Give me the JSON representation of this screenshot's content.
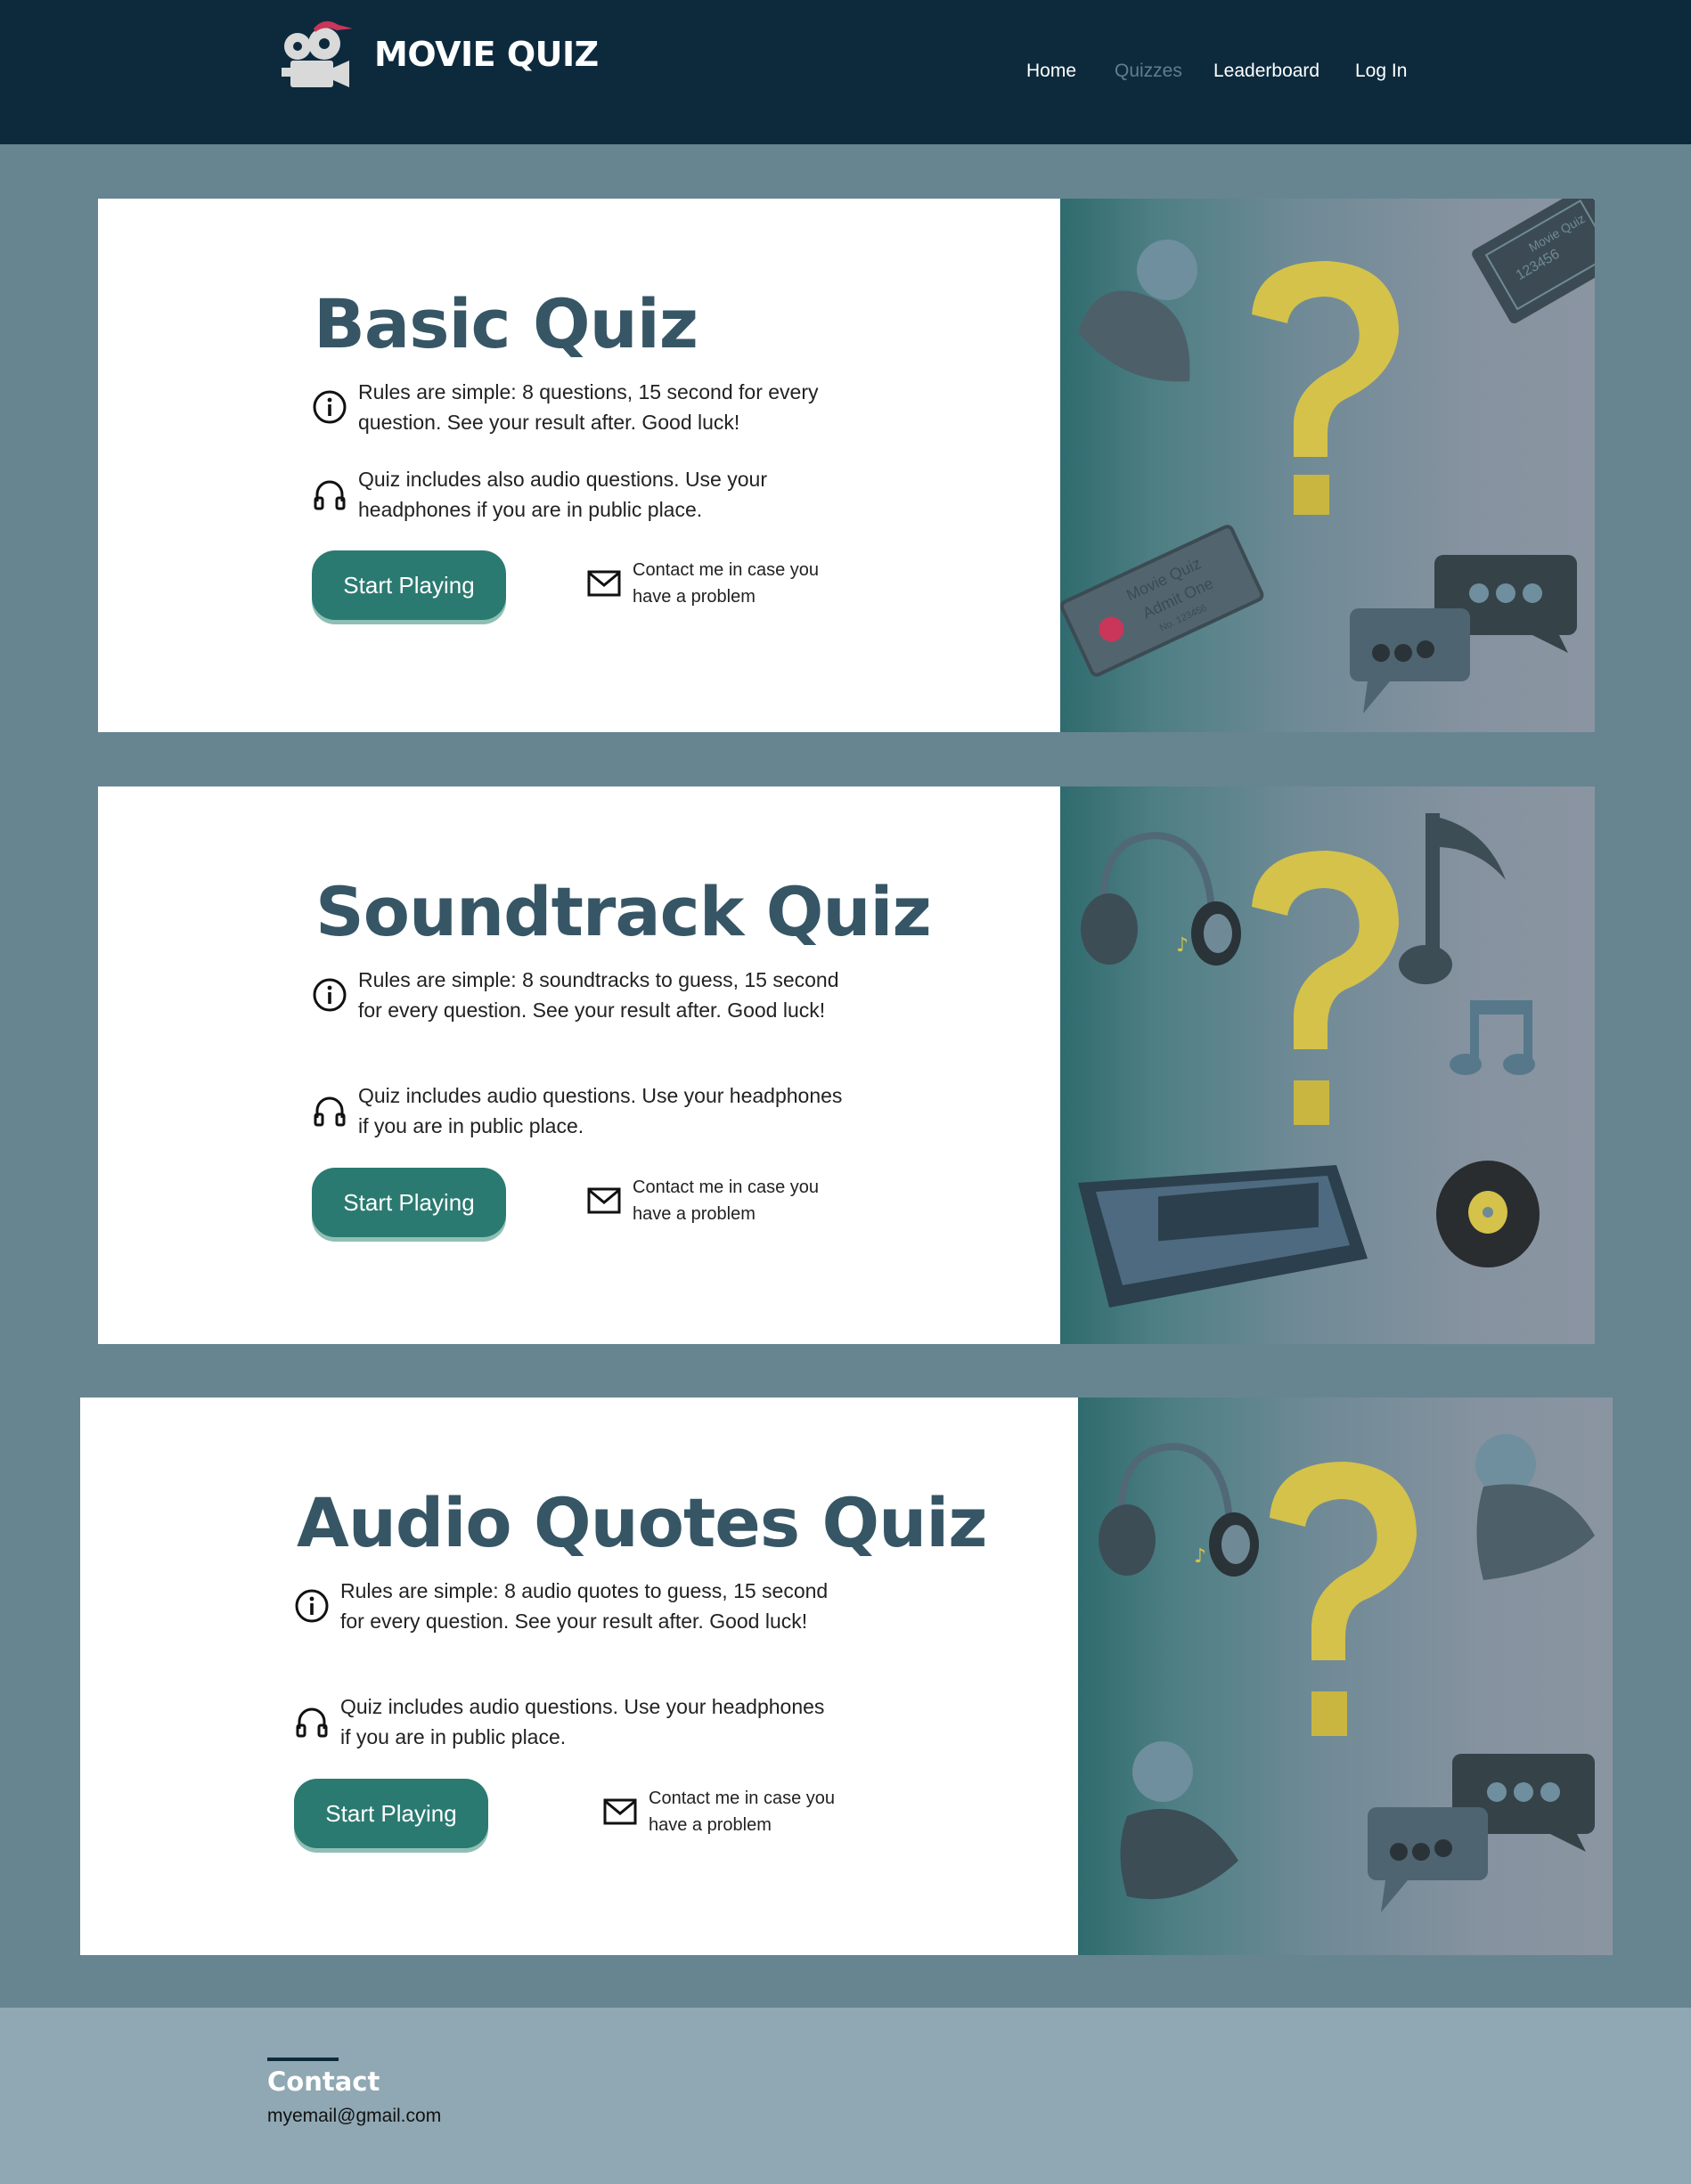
{
  "header": {
    "brand": "MOVIE QUIZ",
    "nav": [
      {
        "label": "Home",
        "active": false
      },
      {
        "label": "Quizzes",
        "active": true
      },
      {
        "label": "Leaderboard",
        "active": false
      },
      {
        "label": "Log In",
        "active": false
      }
    ]
  },
  "quizzes": [
    {
      "title": "Basic Quiz",
      "rules": "Rules are simple: 8 questions, 15 second for every question. See your result after. Good luck!",
      "audio_note": "Quiz includes also audio questions. Use your headphones if you are in public place.",
      "button": "Start Playing",
      "contact": "Contact me in case you have a problem",
      "ticket1": "123456",
      "ticket1_brand": "Movie Quiz",
      "ticket2_brand": "Movie Quiz",
      "ticket2_line": "Admit One",
      "ticket2_no": "No. 123456"
    },
    {
      "title": "Soundtrack Quiz",
      "rules": "Rules are simple: 8 soundtracks to guess, 15 second for every question. See your result after. Good luck!",
      "audio_note": "Quiz includes audio questions. Use your headphones if you are in public place.",
      "button": "Start Playing",
      "contact": "Contact me in case you have a problem"
    },
    {
      "title": "Audio Quotes Quiz",
      "rules": "Rules are simple: 8 audio quotes to guess, 15 second for every question. See your result after. Good luck!",
      "audio_note": "Quiz includes audio questions. Use your headphones if you are in public place.",
      "button": "Start Playing",
      "contact": "Contact me in case you have a problem"
    }
  ],
  "footer": {
    "title": "Contact",
    "email": "myemail@gmail.com"
  },
  "colors": {
    "header_bg": "#0d2a3d",
    "page_bg": "#678591",
    "title": "#365666",
    "button": "#2a7a71",
    "footer_bg": "#8fa8b3",
    "question_mark": "#d8c64a"
  }
}
